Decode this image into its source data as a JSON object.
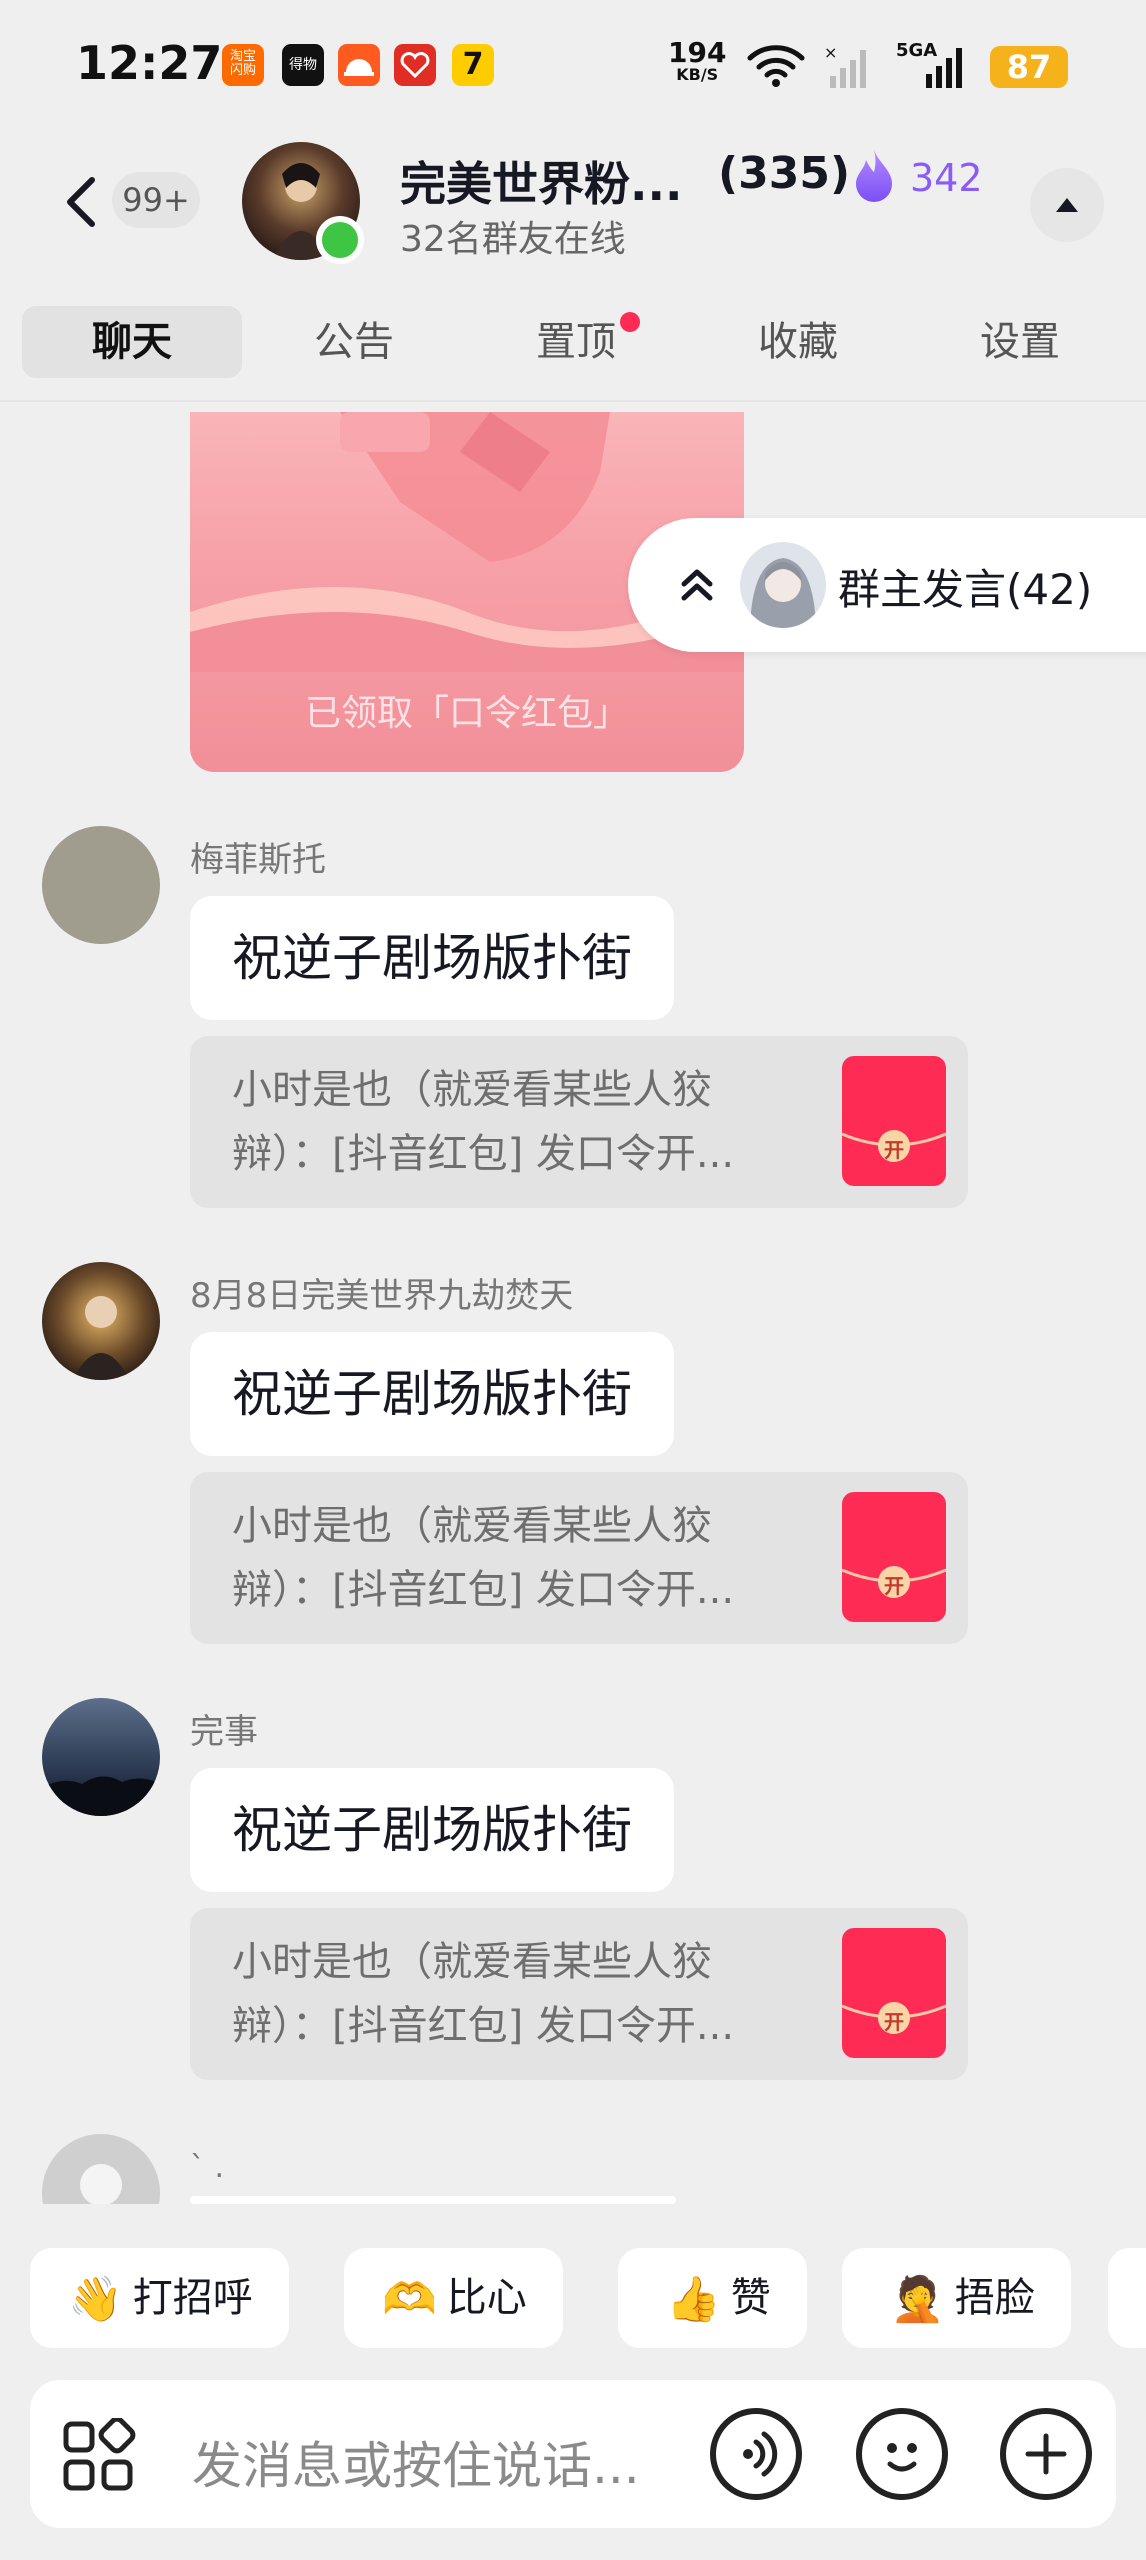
{
  "status_bar": {
    "time": "12:27",
    "network_speed": "194",
    "network_unit": "KB/S",
    "network_type": "5GA",
    "battery": "87",
    "app_icons": [
      {
        "name": "taobao-flash-icon",
        "color": "#ff6a00",
        "label": "淘宝\n闪购"
      },
      {
        "name": "dewu-icon",
        "color": "#111111",
        "label": "得物"
      },
      {
        "name": "app-icon-orange",
        "color": "#ff5a1f",
        "label": ""
      },
      {
        "name": "pinduoduo-icon",
        "color": "#e02e24",
        "label": ""
      },
      {
        "name": "app-icon-yellow",
        "color": "#ffcc00",
        "label": "7"
      }
    ]
  },
  "header": {
    "unread_badge": "99+",
    "group_name": "完美世界粉...",
    "member_count": "(335)",
    "fire_count": "342",
    "online_text": "32名群友在线"
  },
  "tabs": [
    {
      "label": "聊天",
      "active": true
    },
    {
      "label": "公告",
      "active": false
    },
    {
      "label": "置顶",
      "active": false,
      "dot": true
    },
    {
      "label": "收藏",
      "active": false
    },
    {
      "label": "设置",
      "active": false
    }
  ],
  "red_packet": {
    "claimed_text": "已领取「口令红包」"
  },
  "owner_speech": {
    "label": "群主发言(42)"
  },
  "messages": [
    {
      "sender": "梅菲斯托",
      "text": "祝逆子剧场版扑街",
      "quote_line1": "小时是也（就爱看某些人狡",
      "quote_line2": "辩）：[抖音红包] 发口令开...",
      "packet_label": "开"
    },
    {
      "sender": "8月8日完美世界九劫焚天",
      "text": "祝逆子剧场版扑街",
      "quote_line1": "小时是也（就爱看某些人狡",
      "quote_line2": "辩）：[抖音红包] 发口令开...",
      "packet_label": "开"
    },
    {
      "sender": "完事",
      "text": "祝逆子剧场版扑街",
      "quote_line1": "小时是也（就爱看某些人狡",
      "quote_line2": "辩）：[抖音红包] 发口令开...",
      "packet_label": "开"
    }
  ],
  "partial_message": {
    "sender": "` ."
  },
  "quick_replies": [
    {
      "label": "打招呼",
      "emoji": "👋"
    },
    {
      "label": "比心",
      "emoji": "🫶"
    },
    {
      "label": "赞",
      "emoji": "👍"
    },
    {
      "label": "捂脸",
      "emoji": "🤦"
    }
  ],
  "input": {
    "placeholder": "发消息或按住说话..."
  },
  "colors": {
    "accent": "#fe2c55",
    "online": "#3ec543",
    "fire": "#8a5cf6",
    "battery": "#f5b21b"
  }
}
